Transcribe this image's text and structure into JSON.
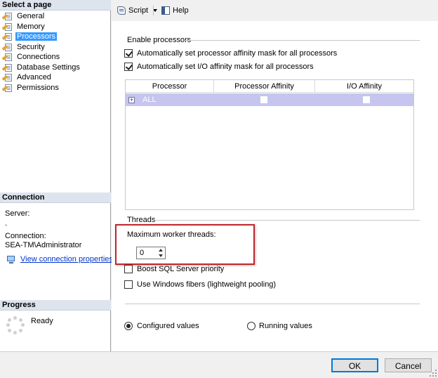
{
  "left": {
    "select_page_header": "Select a page",
    "nav_items": [
      "General",
      "Memory",
      "Processors",
      "Security",
      "Connections",
      "Database Settings",
      "Advanced",
      "Permissions"
    ],
    "selected_index": 2,
    "connection_header": "Connection",
    "server_label": "Server:",
    "server_value": ".",
    "connection_label": "Connection:",
    "connection_value": "SEA-TM\\Administrator",
    "view_link": "View connection properties",
    "progress_header": "Progress",
    "progress_status": "Ready"
  },
  "toolbar": {
    "script_label": "Script",
    "help_label": "Help"
  },
  "processors": {
    "group_title": "Enable processors",
    "cb_affinity_label": "Automatically set processor affinity mask for all processors",
    "cb_affinity_checked": true,
    "cb_io_label": "Automatically set I/O affinity mask for all processors",
    "cb_io_checked": true,
    "columns": [
      "Processor",
      "Processor Affinity",
      "I/O Affinity"
    ],
    "row": {
      "expander": "+",
      "name": "ALL",
      "processor_affinity": false,
      "io_affinity": false
    }
  },
  "threads": {
    "group_title": "Threads",
    "max_worker_label": "Maximum worker threads:",
    "max_worker_value": "0",
    "boost_label": "Boost SQL Server priority",
    "boost_checked": false,
    "fibers_label": "Use Windows fibers (lightweight pooling)",
    "fibers_checked": false
  },
  "values_mode": {
    "configured_label": "Configured values",
    "running_label": "Running values",
    "selected": "configured"
  },
  "buttons": {
    "ok": "OK",
    "cancel": "Cancel"
  },
  "colors": {
    "selection": "#3399ff",
    "header_bg": "#dde4ee",
    "grid_row": "#c5c5f0",
    "highlight": "#c0262d",
    "link": "#0033cc"
  }
}
